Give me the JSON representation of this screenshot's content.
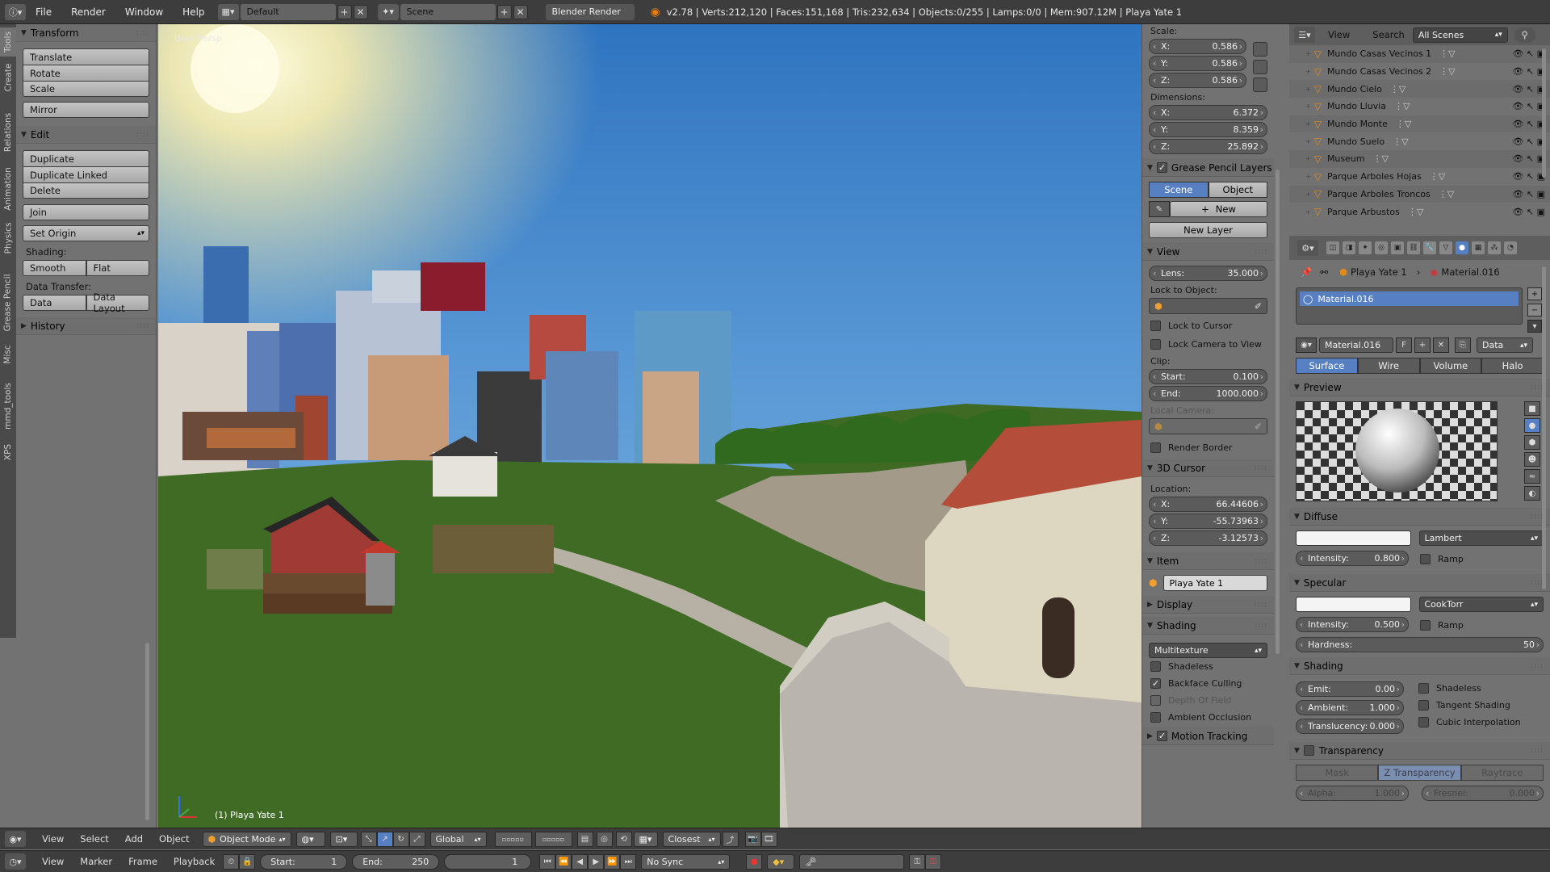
{
  "topbar": {
    "menus": [
      "File",
      "Render",
      "Window",
      "Help"
    ],
    "layout": "Default",
    "scene": "Scene",
    "engine": "Blender Render",
    "stats": "v2.78 | Verts:212,120 | Faces:151,168 | Tris:232,634 | Objects:0/255 | Lamps:0/0 | Mem:907.12M | Playa Yate 1"
  },
  "vtabs": [
    "Tools",
    "Create",
    "Relations",
    "Animation",
    "Physics",
    "Grease Pencil",
    "Misc",
    "mmd_tools",
    "XPS"
  ],
  "toolshelf": {
    "transform_header": "Transform",
    "transform": [
      "Translate",
      "Rotate",
      "Scale"
    ],
    "mirror": "Mirror",
    "edit_header": "Edit",
    "edit": [
      "Duplicate",
      "Duplicate Linked",
      "Delete"
    ],
    "join": "Join",
    "set_origin": "Set Origin",
    "shading_label": "Shading:",
    "smooth": "Smooth",
    "flat": "Flat",
    "data_transfer_label": "Data Transfer:",
    "data": "Data",
    "data_layout": "Data Layout",
    "history_header": "History"
  },
  "viewport": {
    "view_label": "User Persp",
    "object_label": "(1) Playa Yate 1"
  },
  "npanel": {
    "scale_label": "Scale:",
    "scale": [
      {
        "k": "X:",
        "v": "0.586"
      },
      {
        "k": "Y:",
        "v": "0.586"
      },
      {
        "k": "Z:",
        "v": "0.586"
      }
    ],
    "dimensions_label": "Dimensions:",
    "dimensions": [
      {
        "k": "X:",
        "v": "6.372"
      },
      {
        "k": "Y:",
        "v": "8.359"
      },
      {
        "k": "Z:",
        "v": "25.892"
      }
    ],
    "gp_header": "Grease Pencil Layers",
    "gp_scene": "Scene",
    "gp_object": "Object",
    "gp_new": "New",
    "gp_new_layer": "New Layer",
    "view_header": "View",
    "lens_key": "Lens:",
    "lens": "35.000",
    "lock_to_object": "Lock to Object:",
    "lock_cursor": "Lock to Cursor",
    "lock_camera": "Lock Camera to View",
    "clip_label": "Clip:",
    "clip_start_key": "Start:",
    "clip_start": "0.100",
    "clip_end_key": "End:",
    "clip_end": "1000.000",
    "local_camera": "Local Camera:",
    "render_border": "Render Border",
    "cursor_header": "3D Cursor",
    "location_label": "Location:",
    "cursor": [
      {
        "k": "X:",
        "v": "66.44606"
      },
      {
        "k": "Y:",
        "v": "-55.73963"
      },
      {
        "k": "Z:",
        "v": "-3.12573"
      }
    ],
    "item_header": "Item",
    "item_name": "Playa Yate 1",
    "display_header": "Display",
    "shading_header": "Shading",
    "shading_mode": "Multitexture",
    "shadeless": "Shadeless",
    "backface": "Backface Culling",
    "dof": "Depth Of Field",
    "ao": "Ambient Occlusion",
    "motion": "Motion Tracking"
  },
  "outliner": {
    "view": "View",
    "search": "Search",
    "scenes": "All Scenes",
    "rows": [
      "Mundo Casas Vecinos 1",
      "Mundo Casas Vecinos 2",
      "Mundo Cielo",
      "Mundo Lluvia",
      "Mundo Monte",
      "Mundo Suelo",
      "Museum",
      "Parque Arboles Hojas",
      "Parque Arboles Troncos",
      "Parque Arbustos"
    ]
  },
  "props": {
    "object": "Playa Yate 1",
    "material": "Material.016",
    "slot": "Material.016",
    "mat_field": "Material.016",
    "mat_f": "F",
    "data_sel": "Data",
    "tabs": [
      "Surface",
      "Wire",
      "Volume",
      "Halo"
    ],
    "preview_header": "Preview",
    "diffuse_header": "Diffuse",
    "diffuse_shader": "Lambert",
    "diffuse_int_key": "Intensity:",
    "diffuse_int": "0.800",
    "ramp": "Ramp",
    "specular_header": "Specular",
    "specular_shader": "CookTorr",
    "spec_int_key": "Intensity:",
    "spec_int": "0.500",
    "hardness_key": "Hardness:",
    "hardness": "50",
    "shading_header": "Shading",
    "emit_key": "Emit:",
    "emit": "0.00",
    "ambient_key": "Ambient:",
    "ambient": "1.000",
    "transl_key": "Translucency:",
    "transl": "0.000",
    "shadeless": "Shadeless",
    "tangent": "Tangent Shading",
    "cubic": "Cubic Interpolation",
    "transparency_header": "Transparency",
    "tr_tabs": [
      "Mask",
      "Z Transparency",
      "Raytrace"
    ],
    "alpha_key": "Alpha:",
    "alpha": "1.000",
    "fresnel_key": "Fresnel:",
    "fresnel": "0.000"
  },
  "view3d_header": {
    "menus": [
      "View",
      "Select",
      "Add",
      "Object"
    ],
    "mode": "Object Mode",
    "orientation": "Global",
    "snap": "Closest"
  },
  "timeline": {
    "menus": [
      "View",
      "Marker",
      "Frame",
      "Playback"
    ],
    "start_key": "Start:",
    "start": "1",
    "end_key": "End:",
    "end": "250",
    "current": "1",
    "sync": "No Sync"
  }
}
